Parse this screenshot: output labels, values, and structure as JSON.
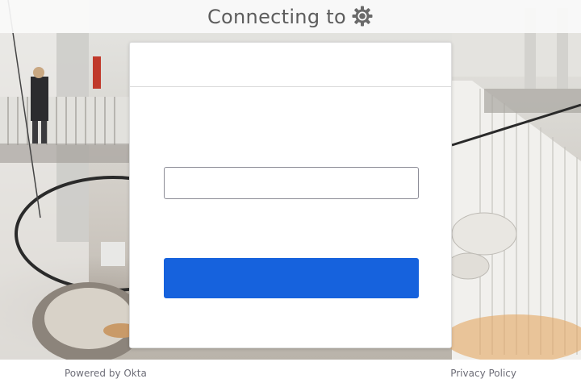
{
  "header": {
    "title": "Connecting to",
    "org_logo_icon": "gear-icon"
  },
  "form": {
    "username_value": "",
    "username_placeholder": "",
    "submit_label": ""
  },
  "footer": {
    "powered_by": "Powered by Okta",
    "privacy": "Privacy Policy"
  },
  "colors": {
    "primary_button": "#1662dd",
    "header_text": "#5d5d5d",
    "footer_link": "#6e6e78"
  }
}
